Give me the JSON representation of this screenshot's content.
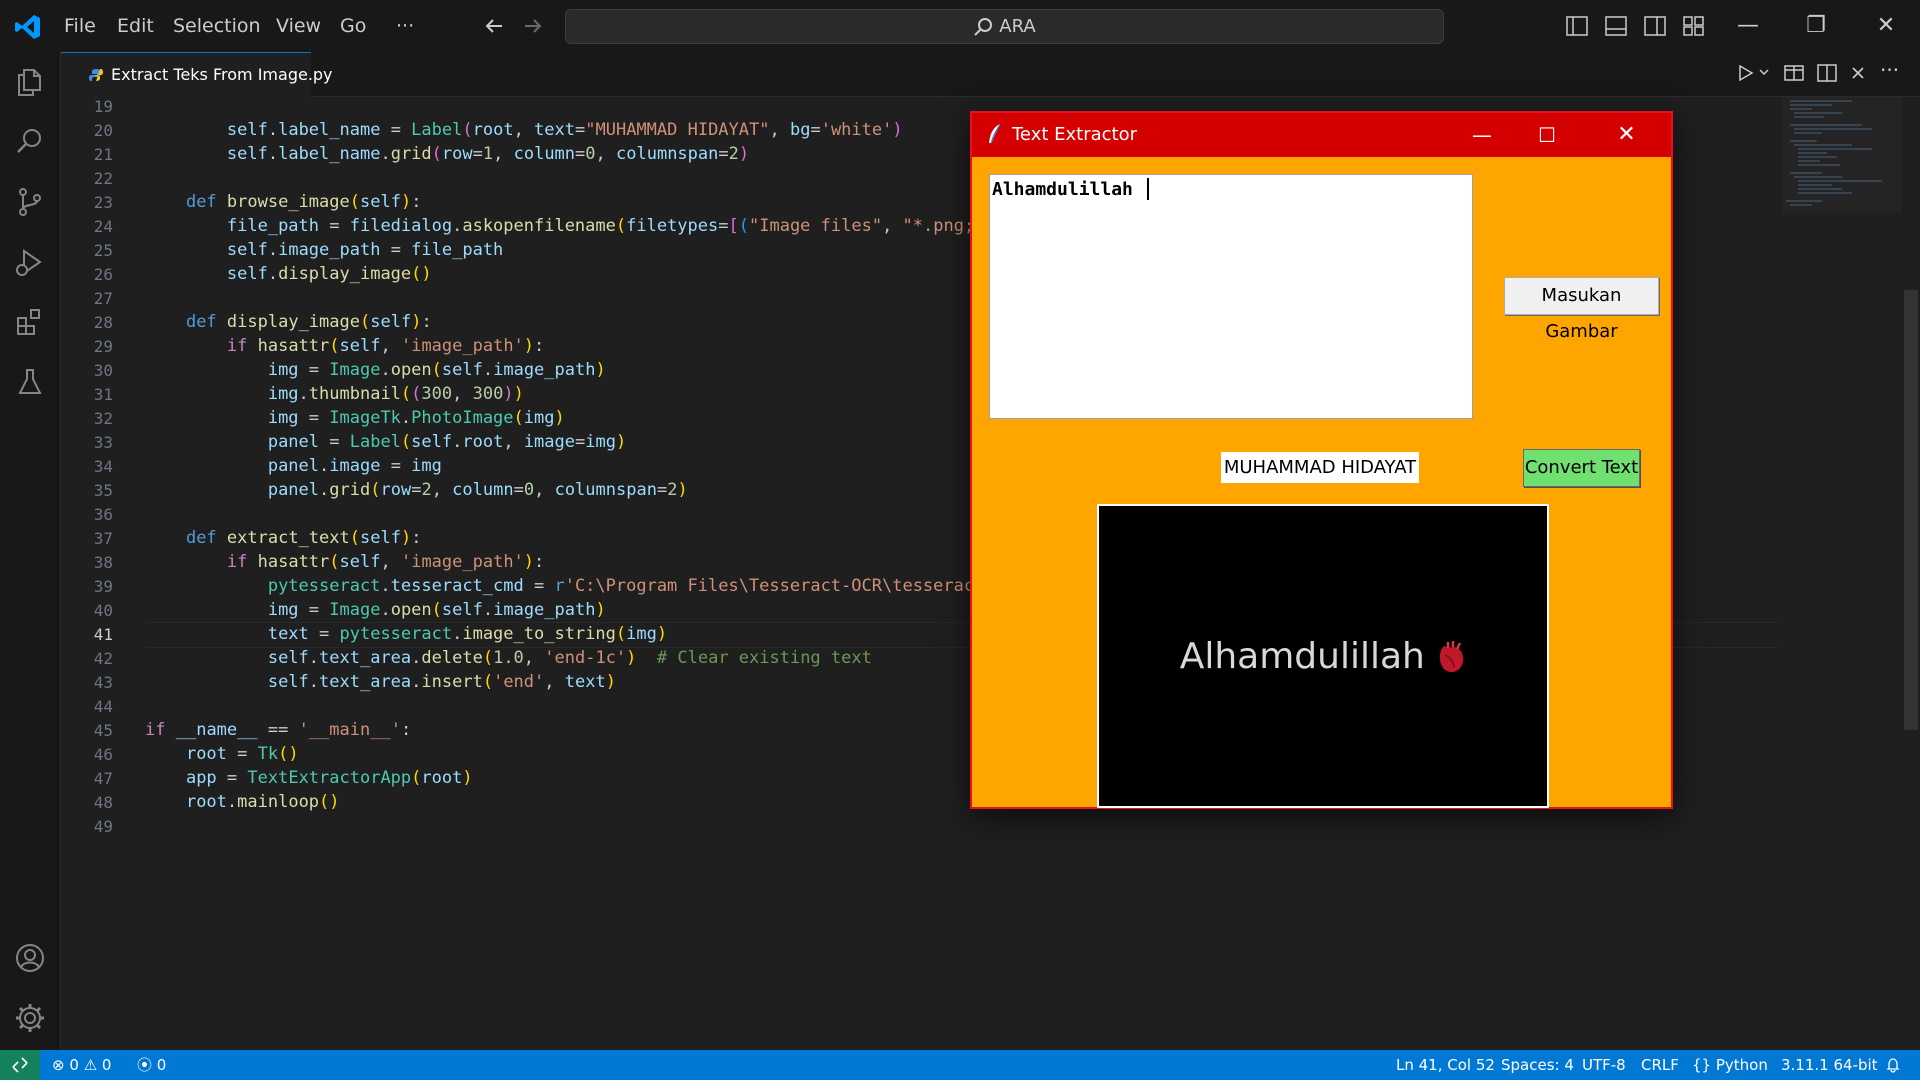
{
  "menu": [
    "File",
    "Edit",
    "Selection",
    "View",
    "Go",
    "···"
  ],
  "search": {
    "label": "ARA"
  },
  "tab": {
    "label": "Extract Teks From Image.py"
  },
  "editor": {
    "line_numbers": [
      "19",
      "20",
      "21",
      "22",
      "23",
      "24",
      "25",
      "26",
      "27",
      "28",
      "29",
      "30",
      "31",
      "32",
      "33",
      "34",
      "35",
      "36",
      "37",
      "38",
      "39",
      "40",
      "41",
      "42",
      "43",
      "44",
      "45",
      "46",
      "47",
      "48",
      "49"
    ],
    "active_line": "41"
  },
  "tk_window": {
    "title": "Text Extractor",
    "textarea_value": "Alhamdulillah",
    "browse_button": "Masukan Gambar",
    "convert_button": "Convert Text",
    "name_label": "MUHAMMAD HIDAYAT",
    "image_text": "Alhamdulillah"
  },
  "statusbar": {
    "errors": "0",
    "warnings": "0",
    "ports": "0",
    "position": "Ln 41, Col 52",
    "spaces": "Spaces: 4",
    "encoding": "UTF-8",
    "eol": "CRLF",
    "language": "Python",
    "interpreter": "3.11.1 64-bit"
  },
  "colors": {
    "accent": "#0078d4",
    "tk_background": "#ffa500",
    "tk_titlebar": "#d40000",
    "convert_button": "#70e070"
  }
}
